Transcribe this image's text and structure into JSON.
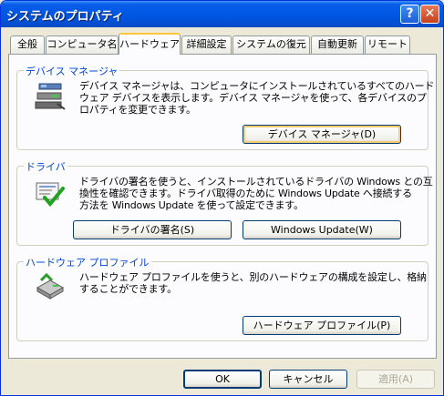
{
  "window": {
    "title": "システムのプロパティ",
    "help_glyph": "?",
    "close_glyph": "✕"
  },
  "tabs": [
    {
      "label": "全般"
    },
    {
      "label": "コンピュータ名"
    },
    {
      "label": "ハードウェア",
      "active": true
    },
    {
      "label": "詳細設定"
    },
    {
      "label": "システムの復元"
    },
    {
      "label": "自動更新"
    },
    {
      "label": "リモート"
    }
  ],
  "device_manager": {
    "label": "デバイス マネージャ",
    "text": "デバイス マネージャは、コンピュータにインストールされているすべてのハード\nウェア デバイスを表示します。デバイス マネージャを使って、各デバイスのプ\nロパティを変更できます。",
    "button": "デバイス マネージャ(D)",
    "icon": "device-manager-icon"
  },
  "drivers": {
    "label": "ドライバ",
    "text": "ドライバの署名を使うと、インストールされているドライバの Windows との互\n換性を確認できます。ドライバ取得のために Windows Update へ接続する\n方法を Windows Update を使って設定できます。",
    "button_signing": "ドライバの署名(S)",
    "button_update": "Windows Update(W)",
    "icon": "driver-check-icon"
  },
  "hardware_profiles": {
    "label": "ハードウェア プロファイル",
    "text": "ハードウェア プロファイルを使うと、別のハードウェアの構成を設定し、格納\nすることができます。",
    "button": "ハードウェア プロファイル(P)",
    "icon": "hardware-profile-icon"
  },
  "footer": {
    "ok": "OK",
    "cancel": "キャンセル",
    "apply": "適用(A)"
  }
}
